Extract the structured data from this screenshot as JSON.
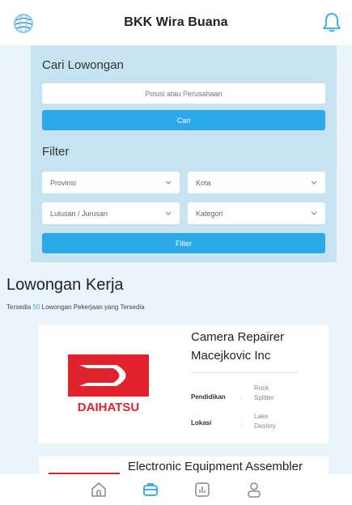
{
  "header": {
    "title": "BKK Wira Buana",
    "logo_icon": "globe-logo-icon",
    "notification_icon": "bell-icon"
  },
  "search": {
    "heading": "Cari Lowongan",
    "placeholder": "Posisi atau Perusahaan",
    "search_button": "Cari",
    "filter_heading": "Filter",
    "province": "Provinsi",
    "city": "Kota",
    "education": "Lulusan / Jurusan",
    "category": "Kategori",
    "filter_button": "Filter"
  },
  "jobs_section": {
    "title": "Lowongan Kerja",
    "sub_prefix": "Tersedia",
    "count": "50",
    "sub_suffix": "Lowongan Pekerjaan yang Tersedia"
  },
  "jobs": [
    {
      "title": "Camera Repairer",
      "company": "Macejkovic Inc",
      "logo_text": "DAIHATSU",
      "education_label": "Pendidikan",
      "education_value": "Rock Splitter",
      "location_label": "Lokasi",
      "location_value": "Lake Destiny"
    },
    {
      "title": "Electronic Equipment Assembler"
    }
  ],
  "bottom_nav": [
    "home-icon",
    "jobs-icon",
    "stats-icon",
    "profile-icon"
  ],
  "colors": {
    "accent": "#2ba9e8",
    "panel": "#c7e3f1",
    "background": "#eaf5fb",
    "brand_red": "#e0232d"
  }
}
